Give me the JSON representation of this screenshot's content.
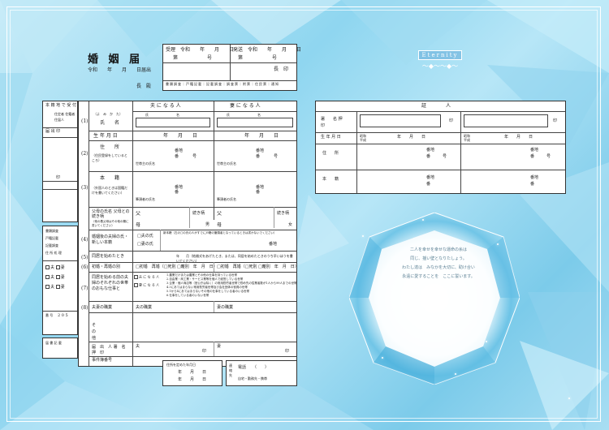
{
  "form": {
    "title": "婚 姻 届",
    "date": "令和　　年　　月　　日届出",
    "addressee": "長　殿",
    "reception": {
      "received": "受理　令和　　年　　月　　日",
      "number": "第　　　　　　号",
      "sent": "発送　令和　　年　　月　　日",
      "sent_number": "第　　　　　　号",
      "head": "長　印",
      "stamps": [
        "書類調査",
        "戸籍記載",
        "記載調査",
        "調査票",
        "附票",
        "住民票",
        "通知"
      ]
    },
    "columns": {
      "husband": "夫 に な る 人",
      "wife": "妻 に な る 人"
    },
    "rows": {
      "r1_num": "(1)",
      "name": "氏　　名",
      "name_reading": "（よ　み　か　た）",
      "family": "氏",
      "given": "名",
      "birth": "生 年 月 日",
      "birth_date": "年　　月　　日",
      "r2_num": "(2)",
      "address": "住　　所",
      "address_note": "（住民登録をしているところ）",
      "banchi": "番地",
      "ban": "番",
      "go": "号",
      "householder": "世帯主の氏名",
      "r3_num": "(3)",
      "honseki": "本　　籍",
      "honseki_note": "（外国人のときは国籍だけを書いてください）",
      "head_name": "筆頭者の氏名",
      "parents": "父母の氏名 父母との続き柄",
      "parents_note": "（他の養父母はその他の欄に書いてください）",
      "father": "父",
      "mother": "母",
      "relation": "続き柄",
      "son": "男",
      "daughter": "女",
      "r4_num": "(4)",
      "new_name": "婚姻後の夫婦の氏・新しい本籍",
      "husband_name_opt": "□夫の氏",
      "wife_name_opt": "□妻の氏",
      "new_honseki": "新本籍（左の□の氏の人がすでに戸籍の筆頭者となっているときは書かないでください）",
      "r5_num": "(5)",
      "cohabit": "同居を始めたとき",
      "cohabit_val": "年　　月（結婚式をあげたとき、または、同居を始めたときのうち早いほうを書いてください）",
      "r6_num": "(6)",
      "first": "初婚・再婚の別",
      "first_opt": "□初婚　再婚（□死別 □離別　年　月　日）",
      "r7_num": "(7)",
      "occupation_type": "同居を始める前の夫婦のそれぞれの世帯のおもな仕事と",
      "r8_num": "(8)",
      "occupation": "夫妻の職業",
      "husband_job": "夫の職業",
      "wife_job": "妻の職業",
      "other": "そ の 他",
      "signature": "届　出　人 署　名　押　印",
      "sig_husband": "夫",
      "sig_wife": "妻",
      "seal": "印",
      "contact": "事件簿番号"
    },
    "occupation_lines": [
      "1.農業だけまたは農業とその他の仕事を持っている世帯",
      "2.自由業・商工業・サービス業等を個人で経営している世帯",
      "3.企業・個人商店等（官公庁は除く）の常用勤労者世帯で勤め先の従業者数が1人から99人までの世帯",
      "4.3にあてはまらない常用勤労者世帯及び会社団体の役員の世帯",
      "5.1から4にあてはまらないその他の仕事をしている者のいる世帯",
      "6.仕事をしている者のいない世帯"
    ],
    "checks": [
      "夫",
      "妻",
      "夫",
      "妻",
      "夫",
      "妻"
    ],
    "side_labels": {
      "received_seal": "本 籍 地 で 受 付",
      "jukyo": "住定者 住籍者 住届人",
      "seal_col": "届 出 印",
      "seal_col2": "印",
      "extra": "連 絡 先",
      "doc": "書類調査",
      "doc2": "戸籍記載",
      "check": "記載調査",
      "cert": "住 所 処 理",
      "num": "番 号",
      "num_val": "2 0 5",
      "list": "届 書 記 載"
    },
    "bottom": {
      "ren": "届 出 人 の 住 所",
      "tel_label": "電話",
      "tel": "（　　）",
      "home": "自宅・勤務先・携帯",
      "cert_date": "住所を定めた年月日",
      "cert_val": "年　　月　　日"
    }
  },
  "witness": {
    "title": "証　　　　人",
    "sign": "署　　名 押　　印",
    "seal": "印",
    "birth": "生 年 月 日",
    "era": "昭和 平成",
    "birth_val": "年　　月　　日",
    "address": "住　　所",
    "banchi": "番地",
    "ban": "番",
    "go": "号",
    "honseki": "本　　籍"
  },
  "message": [
    "二人を幸せを幸せな運命の糸は",
    "同じ、揺い壁となりたしょう。",
    "わたし達は　みなかを大切に、助け合い",
    "永遠に愛することを　ここに誓います。"
  ],
  "logo": {
    "word": "Eternity",
    "wave": "〜◆〜〜◆〜"
  },
  "colors": {
    "background": "#8fd6f0",
    "sheet": "#ffffff",
    "line": "#333333",
    "frame": "#ffffff"
  }
}
